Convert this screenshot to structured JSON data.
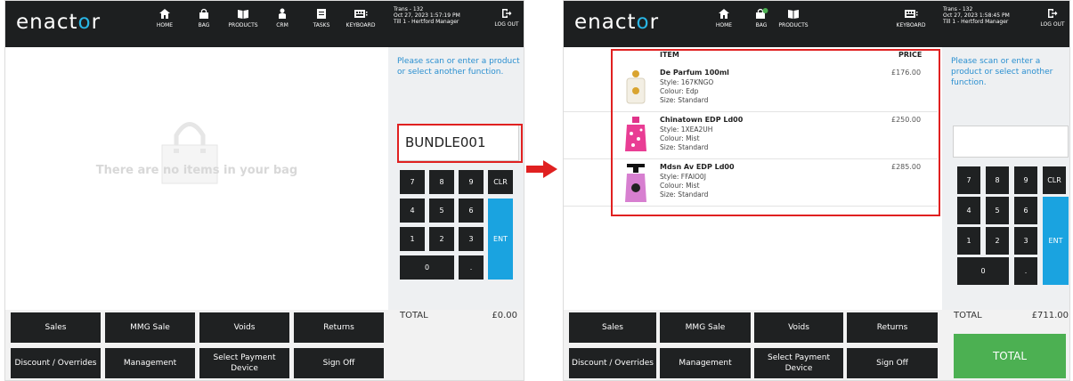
{
  "colors": {
    "brand_accent": "#29b6e6",
    "ent_key": "#1aa3e0",
    "total_button": "#4cb052",
    "highlight": "#e02020",
    "prompt_text": "#2a8fd0"
  },
  "logo": {
    "prefix": "enact",
    "accent": "o",
    "suffix": "r"
  },
  "left": {
    "nav": [
      {
        "label": "HOME",
        "icon": "home-icon"
      },
      {
        "label": "BAG",
        "icon": "bag-icon"
      },
      {
        "label": "PRODUCTS",
        "icon": "book-icon"
      },
      {
        "label": "CRM",
        "icon": "crm-icon"
      },
      {
        "label": "TASKS",
        "icon": "tasks-icon"
      },
      {
        "label": "KEYBOARD",
        "icon": "keyboard-icon"
      }
    ],
    "trans": {
      "line1": "Trans - 132",
      "line2": "Oct 27, 2023 1:57:19 PM",
      "line3": "Till 1 - Hertford Manager"
    },
    "logout": "LOG OUT",
    "prompt": "Please scan or enter a product or select another function.",
    "entry_value": "BUNDLE001",
    "empty_message": "There are no items in your bag",
    "total_label": "TOTAL",
    "total_value": "£0.00"
  },
  "right": {
    "nav": [
      {
        "label": "HOME",
        "icon": "home-icon"
      },
      {
        "label": "BAG",
        "icon": "bag-icon"
      },
      {
        "label": "PRODUCTS",
        "icon": "book-icon"
      },
      {
        "label": "KEYBOARD",
        "icon": "keyboard-icon"
      }
    ],
    "trans": {
      "line1": "Trans - 132",
      "line2": "Oct 27, 2023 1:58:45 PM",
      "line3": "Till 1 - Hertford Manager"
    },
    "logout": "LOG OUT",
    "prompt": "Please scan or enter a product or select another function.",
    "entry_value": "",
    "columns": {
      "item": "ITEM",
      "price": "PRICE"
    },
    "items": [
      {
        "name": "De Parfum 100ml",
        "style": "Style: 167KNGO",
        "colour": "Colour: Edp",
        "size": "Size: Standard",
        "price": "£176.00"
      },
      {
        "name": "Chinatown EDP Ld00",
        "style": "Style: 1XEA2UH",
        "colour": "Colour: Mist",
        "size": "Size: Standard",
        "price": "£250.00"
      },
      {
        "name": "Mdsn Av EDP Ld00",
        "style": "Style: FFAIO0J",
        "colour": "Colour: Mist",
        "size": "Size: Standard",
        "price": "£285.00"
      }
    ],
    "total_label": "TOTAL",
    "total_value": "£711.00",
    "total_button": "TOTAL"
  },
  "keypad": {
    "row1": [
      "7",
      "8",
      "9",
      "CLR"
    ],
    "row2": [
      "4",
      "5",
      "6"
    ],
    "row3": [
      "1",
      "2",
      "3"
    ],
    "row4": [
      "0",
      "."
    ],
    "enter": "ENT"
  },
  "function_buttons": [
    {
      "label": "Sales"
    },
    {
      "label": "MMG Sale"
    },
    {
      "label": "Voids"
    },
    {
      "label": "Returns"
    },
    {
      "label": "Discount / Overrides"
    },
    {
      "label": "Management"
    },
    {
      "label": "Select Payment Device"
    },
    {
      "label": "Sign Off"
    }
  ]
}
